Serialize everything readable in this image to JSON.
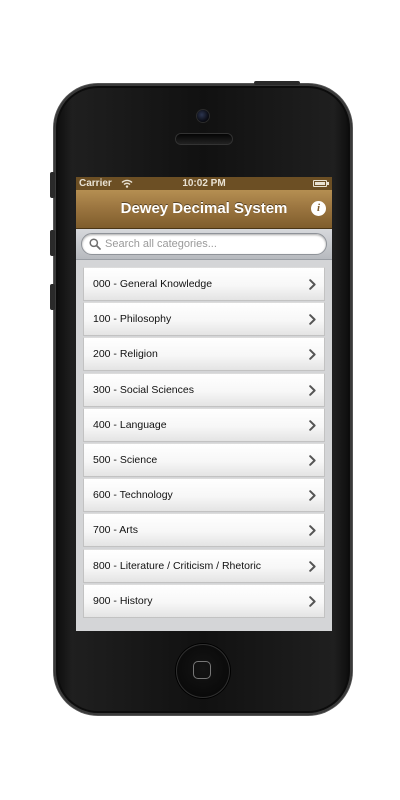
{
  "status_bar": {
    "carrier": "Carrier",
    "time": "10:02 PM",
    "wifi_icon": "wifi-icon",
    "battery_icon": "battery-icon"
  },
  "nav_bar": {
    "title": "Dewey Decimal System",
    "info_icon": "info-icon",
    "info_glyph": "i"
  },
  "search": {
    "placeholder": "Search all categories...",
    "value": "",
    "icon": "search-icon"
  },
  "categories": [
    {
      "label": "000 - General Knowledge"
    },
    {
      "label": "100 - Philosophy"
    },
    {
      "label": "200 - Religion"
    },
    {
      "label": "300 - Social Sciences"
    },
    {
      "label": "400 - Language"
    },
    {
      "label": "500 - Science"
    },
    {
      "label": "600 - Technology"
    },
    {
      "label": "700 - Arts"
    },
    {
      "label": "800 - Literature / Criticism / Rhetoric"
    },
    {
      "label": "900 - History"
    }
  ],
  "colors": {
    "nav_bar_top": "#b58f52",
    "nav_bar_bottom": "#7f5d2c",
    "status_bar": "#6c4f24",
    "list_background": "#d4d5d7",
    "phone_body": "#111111"
  }
}
